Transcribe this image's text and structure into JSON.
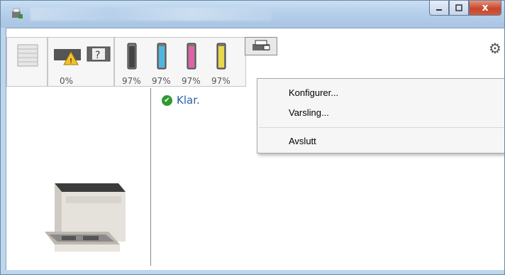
{
  "toolbar": {
    "paper_counter": "0%",
    "toners": [
      "97%",
      "97%",
      "97%",
      "97%"
    ],
    "toner_colors": [
      "#444444",
      "#4fb6e0",
      "#e063a8",
      "#e8d84a"
    ]
  },
  "status": {
    "text": "Klar."
  },
  "context_menu": {
    "items": [
      "Konfigurer...",
      "Varsling...",
      "Avslutt"
    ]
  },
  "titlebar": {
    "close_label": "x"
  }
}
